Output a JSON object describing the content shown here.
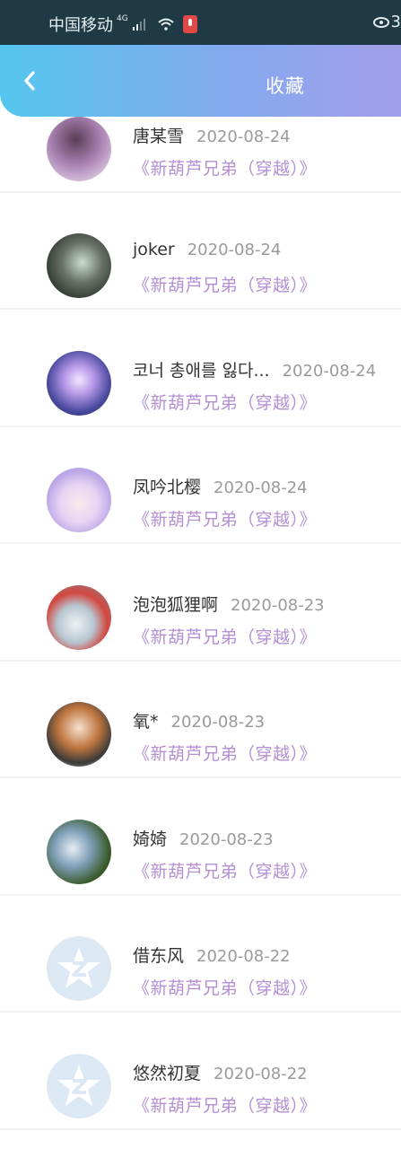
{
  "status_bar": {
    "carrier": "中国移动",
    "network": "4G",
    "battery_partial": "3"
  },
  "header": {
    "title": "收藏"
  },
  "colors": {
    "header_gradient_start": "#55c7ef",
    "header_gradient_end": "#a3a0ea",
    "link_purple": "#b48fd3"
  },
  "favorites": [
    {
      "name": "唐某雪",
      "date": "2020-08-24",
      "title": "《新葫芦兄弟（穿越）》",
      "avatar": "avatar-girl-purple"
    },
    {
      "name": "joker",
      "date": "2020-08-24",
      "title": "《新葫芦兄弟（穿越）》",
      "avatar": "avatar-curly-hair"
    },
    {
      "name": "코너 총애를 잃다...",
      "date": "2020-08-24",
      "title": "《新葫芦兄弟（穿越）》",
      "avatar": "avatar-anime-blue"
    },
    {
      "name": "凤吟北樱",
      "date": "2020-08-24",
      "title": "《新葫芦兄弟（穿越）》",
      "avatar": "avatar-anime-lilac"
    },
    {
      "name": "泡泡狐狸啊",
      "date": "2020-08-23",
      "title": "《新葫芦兄弟（穿越）》",
      "avatar": "avatar-red-fox"
    },
    {
      "name": "氧*",
      "date": "2020-08-23",
      "title": "《新葫芦兄弟（穿越）》",
      "avatar": "avatar-geisha"
    },
    {
      "name": "婍婍",
      "date": "2020-08-23",
      "title": "《新葫芦兄弟（穿越）》",
      "avatar": "avatar-dark-green"
    },
    {
      "name": "借东风",
      "date": "2020-08-22",
      "title": "《新葫芦兄弟（穿越）》",
      "avatar": "default-qzone-icon"
    },
    {
      "name": "悠然初夏",
      "date": "2020-08-22",
      "title": "《新葫芦兄弟（穿越）》",
      "avatar": "default-qzone-icon"
    }
  ]
}
